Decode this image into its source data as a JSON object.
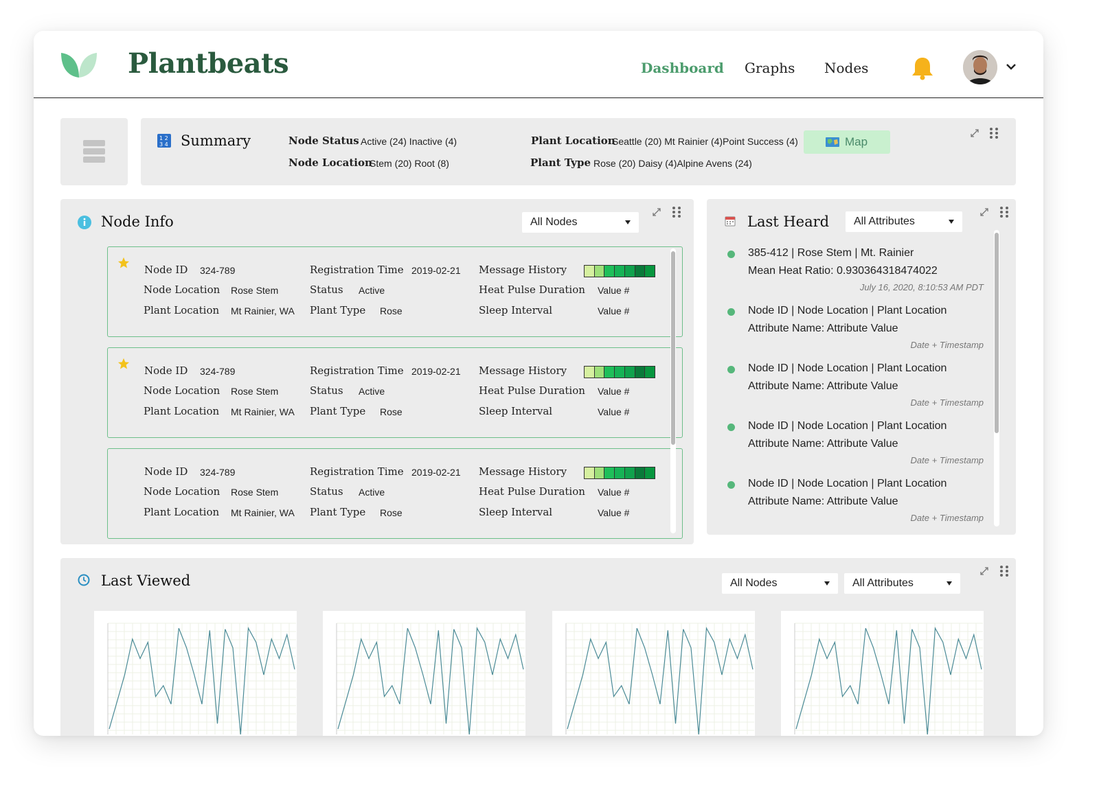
{
  "app": {
    "brand": "Plantbeats"
  },
  "nav": {
    "items": [
      {
        "label": "Dashboard",
        "active": true
      },
      {
        "label": "Graphs",
        "active": false
      },
      {
        "label": "Nodes",
        "active": false
      }
    ]
  },
  "summary": {
    "title": "Summary",
    "node_status_label": "Node Status",
    "node_status_value": "Active (24) Inactive (4)",
    "node_location_label": "Node Location",
    "node_location_value": "Stem (20) Root (8)",
    "plant_location_label": "Plant Location",
    "plant_location_value": "Seattle (20) Mt Rainier (4)Point Success (4)",
    "plant_type_label": "Plant Type",
    "plant_type_value": "Rose (20) Daisy (4)Alpine Avens (24)",
    "map_label": "Map"
  },
  "node_info": {
    "title": "Node Info",
    "filter": "All Nodes",
    "labels": {
      "node_id": "Node ID",
      "node_location": "Node Location",
      "plant_location": "Plant Location",
      "registration_time": "Registration Time",
      "status": "Status",
      "plant_type": "Plant Type",
      "message_history": "Message History",
      "heat_pulse": "Heat Pulse Duration",
      "sleep_interval": "Sleep Interval"
    },
    "history_colors": [
      "#d6f0a0",
      "#9fe07a",
      "#1fbf5a",
      "#16b356",
      "#10a24d",
      "#0a7a3a",
      "#08963f"
    ],
    "cards": [
      {
        "starred": true,
        "node_id": "324-789",
        "node_location": "Rose Stem",
        "plant_location": "Mt Rainier, WA",
        "registration_time": "2019-02-21",
        "status": "Active",
        "plant_type": "Rose",
        "heat_pulse": "Value #",
        "sleep_interval": "Value #"
      },
      {
        "starred": true,
        "node_id": "324-789",
        "node_location": "Rose Stem",
        "plant_location": "Mt Rainier, WA",
        "registration_time": "2019-02-21",
        "status": "Active",
        "plant_type": "Rose",
        "heat_pulse": "Value #",
        "sleep_interval": "Value #"
      },
      {
        "starred": false,
        "node_id": "324-789",
        "node_location": "Rose Stem",
        "plant_location": "Mt Rainier, WA",
        "registration_time": "2019-02-21",
        "status": "Active",
        "plant_type": "Rose",
        "heat_pulse": "Value #",
        "sleep_interval": "Value #"
      }
    ]
  },
  "last_heard": {
    "title": "Last Heard",
    "filter": "All Attributes",
    "items": [
      {
        "line1": "385-412 | Rose Stem | Mt. Rainier",
        "line2": "Mean Heat Ratio: 0.930364318474022",
        "date": "July 16, 2020, 8:10:53 AM PDT"
      },
      {
        "line1": "Node ID | Node Location | Plant Location",
        "line2": "Attribute Name: Attribute Value",
        "date": "Date + Timestamp"
      },
      {
        "line1": "Node ID | Node Location | Plant Location",
        "line2": "Attribute Name: Attribute Value",
        "date": "Date + Timestamp"
      },
      {
        "line1": "Node ID | Node Location | Plant Location",
        "line2": "Attribute Name: Attribute Value",
        "date": "Date + Timestamp"
      },
      {
        "line1": "Node ID | Node Location | Plant Location",
        "line2": "Attribute Name: Attribute Value",
        "date": "Date + Timestamp"
      }
    ]
  },
  "last_viewed": {
    "title": "Last Viewed",
    "filter_nodes": "All Nodes",
    "filter_attributes": "All Attributes",
    "chart_line_color": "#4a8a96",
    "charts": [
      {
        "values": [
          0.05,
          0.3,
          0.55,
          0.88,
          0.7,
          0.85,
          0.35,
          0.45,
          0.28,
          0.98,
          0.8,
          0.55,
          0.28,
          0.96,
          0.1,
          0.97,
          0.8,
          0.0,
          0.98,
          0.85,
          0.55,
          0.88,
          0.7,
          0.92,
          0.6
        ]
      },
      {
        "values": [
          0.05,
          0.3,
          0.55,
          0.88,
          0.7,
          0.85,
          0.35,
          0.45,
          0.28,
          0.98,
          0.8,
          0.55,
          0.28,
          0.96,
          0.1,
          0.97,
          0.8,
          0.0,
          0.98,
          0.85,
          0.55,
          0.88,
          0.7,
          0.92,
          0.6
        ]
      },
      {
        "values": [
          0.05,
          0.3,
          0.55,
          0.88,
          0.7,
          0.85,
          0.35,
          0.45,
          0.28,
          0.98,
          0.8,
          0.55,
          0.28,
          0.96,
          0.1,
          0.97,
          0.8,
          0.0,
          0.98,
          0.85,
          0.55,
          0.88,
          0.7,
          0.92,
          0.6
        ]
      },
      {
        "values": [
          0.05,
          0.3,
          0.55,
          0.88,
          0.7,
          0.85,
          0.35,
          0.45,
          0.28,
          0.98,
          0.8,
          0.55,
          0.28,
          0.96,
          0.1,
          0.97,
          0.8,
          0.0,
          0.98,
          0.85,
          0.55,
          0.88,
          0.7,
          0.92,
          0.6
        ]
      }
    ]
  },
  "colors": {
    "brand": "#2a5a3e",
    "accent": "#4c9c6d",
    "panel": "#ececec",
    "bell": "#f6b21b"
  }
}
